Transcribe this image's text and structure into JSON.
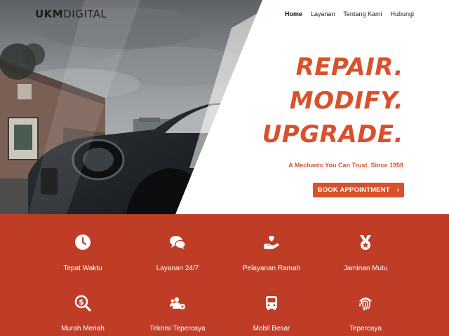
{
  "header": {
    "logo_bold": "UKM",
    "logo_light": "DIGITAL",
    "nav": [
      {
        "label": "Home",
        "active": true
      },
      {
        "label": "Layanan",
        "active": false
      },
      {
        "label": "Tentang Kami",
        "active": false
      },
      {
        "label": "Hubungi",
        "active": false
      }
    ]
  },
  "hero": {
    "headline": [
      "REPAIR.",
      "MODIFY.",
      "UPGRADE."
    ],
    "tagline": "A Mechanic You Can Trust. Since 1958",
    "cta_label": "BOOK APPOINTMENT",
    "cta_icon": "chevron-right-icon"
  },
  "features": [
    {
      "label": "Tepat Waktu",
      "icon": "clock-icon"
    },
    {
      "label": "Layanan 24/7",
      "icon": "chat-bubbles-icon"
    },
    {
      "label": "Pelayanan Ramah",
      "icon": "heart-hand-icon"
    },
    {
      "label": "Jaminan Mutu",
      "icon": "medal-icon"
    },
    {
      "label": "Murah Meriah",
      "icon": "dollar-search-icon"
    },
    {
      "label": "Teknisi Tepercaya",
      "icon": "users-gear-icon"
    },
    {
      "label": "Mobil Besar",
      "icon": "bus-icon"
    },
    {
      "label": "Tepercaya",
      "icon": "fingerprint-icon"
    }
  ],
  "colors": {
    "accent": "#d9512c",
    "features_bg": "#bf3d26",
    "text_dark": "#1d1d1d",
    "white": "#ffffff"
  }
}
